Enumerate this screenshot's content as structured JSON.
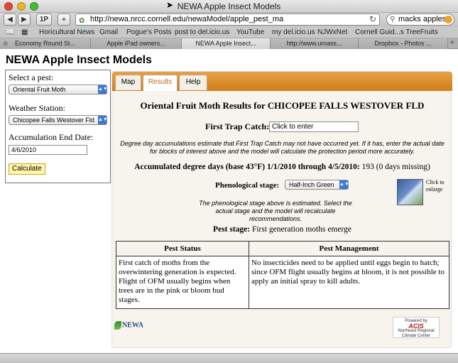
{
  "window": {
    "title": "NEWA Apple Insect Models"
  },
  "toolbar": {
    "back": "◀",
    "forward": "▶",
    "onep": "1P",
    "add": "+",
    "url": "http://newa.nrcc.cornell.edu/newaModel/apple_pest_ma",
    "search_value": "macks apples"
  },
  "bookmarks": [
    "Horicultural News",
    "Gmail",
    "Pogue's Posts",
    "post to del.icio.us",
    "YouTube",
    "my del.icio.us",
    "NJWxNet",
    "Cornell Guid...s TreeFruits"
  ],
  "tabs": [
    "Economy Round St...",
    "Apple iPad owners...",
    "NEWA Apple Insect...",
    "http://www.umass...",
    "Dropbox - Photos ..."
  ],
  "page": {
    "title": "NEWA Apple Insect Models"
  },
  "sidebar": {
    "pest_label": "Select a pest:",
    "pest_value": "Oriental Fruit Moth",
    "station_label": "Weather Station:",
    "station_value": "Chicopee Falls Westover Fld",
    "date_label": "Accumulation End Date:",
    "date_value": "4/6/2010",
    "calculate_label": "Calculate"
  },
  "panel": {
    "tabs": [
      "Map",
      "Results",
      "Help"
    ],
    "results_title": "Oriental Fruit Moth Results for CHICOPEE FALLS WESTOVER FLD",
    "first_trap_label": "First Trap Catch:",
    "first_trap_value": "Click to enter",
    "dd_note": "Degree day accumulations estimate that First Trap Catch may not have occurred yet. If it has, enter the actual date for blocks of interest above and the model will calculate the protection period more accurately.",
    "dd_label": "Accumulated degree days (base 43°F) 1/1/2010 through 4/5/2010:",
    "dd_value": "193 (0 days missing)",
    "pheno_label": "Phenological stage:",
    "pheno_value": "Half-Inch Green",
    "enlarge_label": "Click to enlarge",
    "pheno_note": "The phenological stage above is estimated. Select the actual stage and the model will recalculate recommendations.",
    "pest_stage_label": "Pest stage:",
    "pest_stage_value": "First generation moths emerge",
    "table": {
      "headers": [
        "Pest Status",
        "Pest Management"
      ],
      "status": "First catch of moths from the overwintering generation is expected. Flight of OFM usually begins when trees are in the pink or bloom bud stages.",
      "management": "No insecticides need to be applied until eggs begin to hatch; since OFM flight usually begins at bloom, it is not possible to apply an initial spray to kill adults."
    },
    "newa_logo": "NEWA",
    "acis_powered": "Powered by",
    "acis_name": "ACIS",
    "acis_sub": "Northeast Regional Climate Center"
  }
}
